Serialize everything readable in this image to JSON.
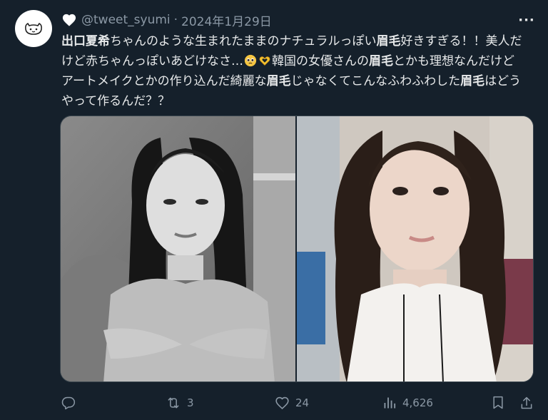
{
  "tweet": {
    "handle": "@tweet_syumi",
    "separator": "·",
    "date": "2024年1月29日",
    "more_label": "···",
    "body_parts": [
      {
        "text": "出口夏希",
        "bold": true
      },
      {
        "text": "ちゃんのような生まれたままのナチュラルっぽい",
        "bold": false
      },
      {
        "text": "眉毛",
        "bold": true
      },
      {
        "text": "好きすぎる！！美人だけど赤ちゃんっぽいあどけなさ…",
        "bold": false
      },
      {
        "emoji": "pleading-face"
      },
      {
        "emoji": "heart-hands"
      },
      {
        "text": "韓国の女優さんの",
        "bold": false
      },
      {
        "text": "眉毛",
        "bold": true
      },
      {
        "text": "とかも理想なんだけどアートメイクとかの作り込んだ綺麗な",
        "bold": false
      },
      {
        "text": "眉毛",
        "bold": true
      },
      {
        "text": "じゃなくてこんなふわふわした",
        "bold": false
      },
      {
        "text": "眉毛",
        "bold": true
      },
      {
        "text": "はどうやって作るんだ？？",
        "bold": false
      }
    ]
  },
  "media": {
    "left_photo": "monochrome-portrait-photo",
    "right_photo": "color-selfie-photo"
  },
  "actions": {
    "reply": {
      "icon": "reply-icon",
      "count": ""
    },
    "retweet": {
      "icon": "retweet-icon",
      "count": "3"
    },
    "like": {
      "icon": "like-icon",
      "count": "24"
    },
    "views": {
      "icon": "views-icon",
      "count": "4,626"
    },
    "bookmark": {
      "icon": "bookmark-icon",
      "count": ""
    },
    "share": {
      "icon": "share-icon",
      "count": ""
    }
  },
  "colors": {
    "background": "#15202b",
    "text": "#e7e9ea",
    "muted": "#8b98a5"
  }
}
